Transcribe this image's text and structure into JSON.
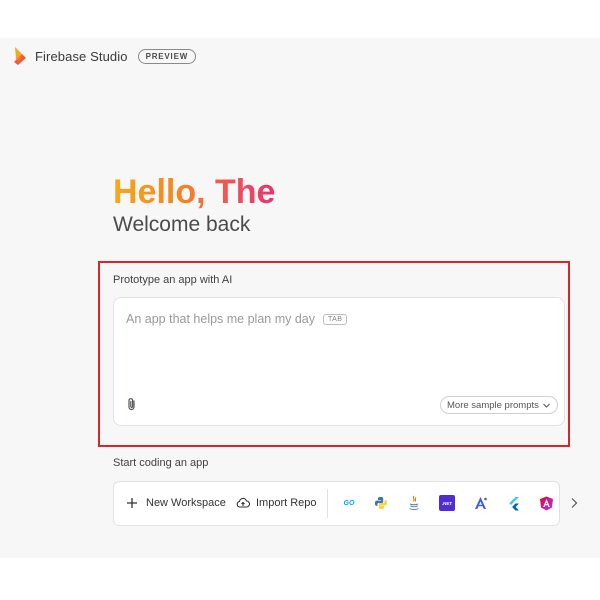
{
  "header": {
    "brand_name": "Firebase Studio",
    "badge": "PREVIEW",
    "logo_icon": "firebase-flame-icon"
  },
  "hero": {
    "greeting": "Hello, The",
    "subtitle": "Welcome back"
  },
  "prototype": {
    "label": "Prototype an app with AI",
    "input_placeholder": "An app that helps me plan my day",
    "tab_hint": "TAB",
    "attach_icon": "paperclip-icon",
    "more_prompts_label": "More sample prompts"
  },
  "coding": {
    "label": "Start coding an app",
    "new_workspace_label": "New Workspace",
    "import_repo_label": "Import Repo",
    "tech_icons": [
      "go-icon",
      "python-icon",
      "java-icon",
      "dotnet-icon",
      "angular-react-icon",
      "flutter-icon",
      "angular-icon"
    ],
    "dotnet_text": ".NET",
    "go_text": "GO"
  },
  "colors": {
    "highlight": "#d8262a",
    "greeting_gradient": [
      "#f5a91a",
      "#f58025",
      "#ef4f5c",
      "#e5356f"
    ]
  }
}
